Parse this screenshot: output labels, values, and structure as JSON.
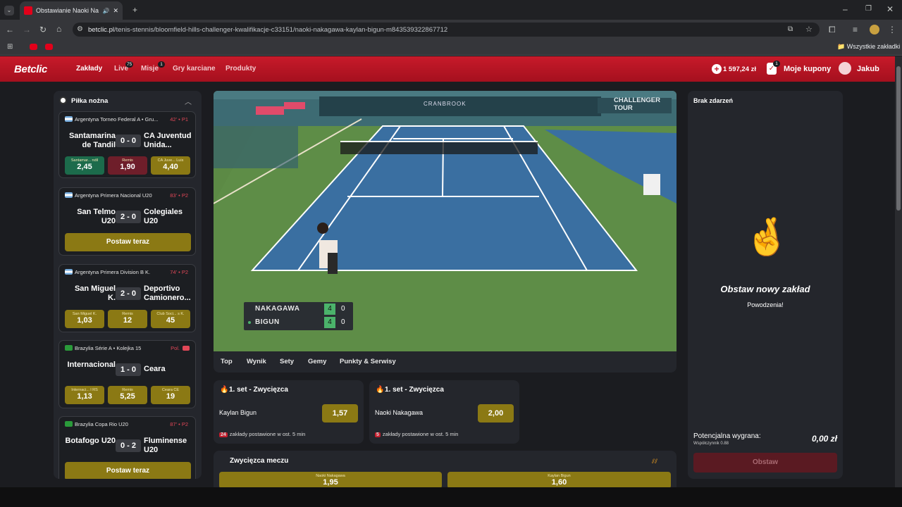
{
  "browser": {
    "tab_title": "Obstawianie Naoki Nakagawa",
    "url_host": "betclic.pl",
    "url_path": "/tenis-stennis/bloomfield-hills-challenger-kwalifikacje-c33151/naoki-nakagawa-kaylan-bigun-m843539322867712",
    "bookmarks_all": "Wszystkie zakładki"
  },
  "header": {
    "logo": "Betclic",
    "nav": {
      "bets": "Zakłady",
      "live": "Live",
      "live_count": "75",
      "missions": "Misje",
      "missions_count": "1",
      "cards": "Gry karciane",
      "products": "Produkty"
    },
    "balance": "1 597,24 zł",
    "coupons": "Moje kupony",
    "coupons_count": "1",
    "user": "Jakub"
  },
  "sidebar": {
    "sport": "Piłka nożna",
    "postaw": "Postaw teraz",
    "matches": [
      {
        "league": "Argentyna Torneo Federal A • Gru...",
        "time": "42' • P1",
        "home": "Santamarina de Tandil",
        "away": "CA Juventud Unida...",
        "score": "0 - 0",
        "odds": [
          {
            "label": "Santamar... ndil",
            "value": "2,45"
          },
          {
            "label": "Remis",
            "value": "1,90"
          },
          {
            "label": "CA Juve... Luis",
            "value": "4,40"
          }
        ]
      },
      {
        "league": "Argentyna Primera Nacional U20",
        "time": "83' • P2",
        "home": "San Telmo U20",
        "away": "Colegiales U20",
        "score": "2 - 0"
      },
      {
        "league": "Argentyna Primera Division B K.",
        "time": "74' • P2",
        "home": "San Miguel K.",
        "away": "Deportivo Camionero...",
        "score": "2 - 0",
        "odds": [
          {
            "label": "San Miguel K.",
            "value": "1,03"
          },
          {
            "label": "Remis",
            "value": "12"
          },
          {
            "label": "Club Soci... s K.",
            "value": "45"
          }
        ]
      },
      {
        "league": "Brazylia Série A • Kolejka 15",
        "time": "Pol.",
        "home": "Internacional",
        "away": "Ceara",
        "score": "1 - 0",
        "odds": [
          {
            "label": "Internaci... l RS",
            "value": "1,13"
          },
          {
            "label": "Remis",
            "value": "5,25"
          },
          {
            "label": "Ceara CE",
            "value": "19"
          }
        ]
      },
      {
        "league": "Brazylia Copa Rio U20",
        "time": "87' • P2",
        "home": "Botafogo U20",
        "away": "Fluminense U20",
        "score": "0 - 2"
      }
    ]
  },
  "video": {
    "scoreboard": [
      {
        "name": "NAKAGAWA",
        "games": "4",
        "points": "0"
      },
      {
        "name": "BIGUN",
        "games": "4",
        "points": "0"
      }
    ],
    "banner": "CHALLENGER TOUR",
    "sponsor": "CRANBROOK"
  },
  "tabs": [
    "Top",
    "Wynik",
    "Sety",
    "Gemy",
    "Punkty & Serwisy"
  ],
  "markets": [
    {
      "title": "1. set - Zwycięzca",
      "player": "Kaylan Bigun",
      "odd": "1,57",
      "count": "24",
      "count_text": "zakłady postawione w ost. 5 min"
    },
    {
      "title": "1. set - Zwycięzca",
      "player": "Naoki Nakagawa",
      "odd": "2,00",
      "count": "5",
      "count_text": "zakłady postawione w ost. 5 min"
    }
  ],
  "match_winner": {
    "title": "Zwycięzca meczu",
    "options": [
      {
        "label": "Naoki Nakagawa",
        "value": "1,95"
      },
      {
        "label": "Kaylan Bigun",
        "value": "1,60"
      }
    ]
  },
  "slip": {
    "empty": "Brak zdarzeń",
    "headline": "Obstaw nowy zakład",
    "sub": "Powodzenia!",
    "potential": "Potencjalna wygrana:",
    "coef": "Współczynnik 0.88",
    "amount": "0,00 zł",
    "button": "Obstaw"
  },
  "colors": {
    "brand": "#c71a2a",
    "odd": "#8b7914",
    "panel": "#24262c"
  }
}
